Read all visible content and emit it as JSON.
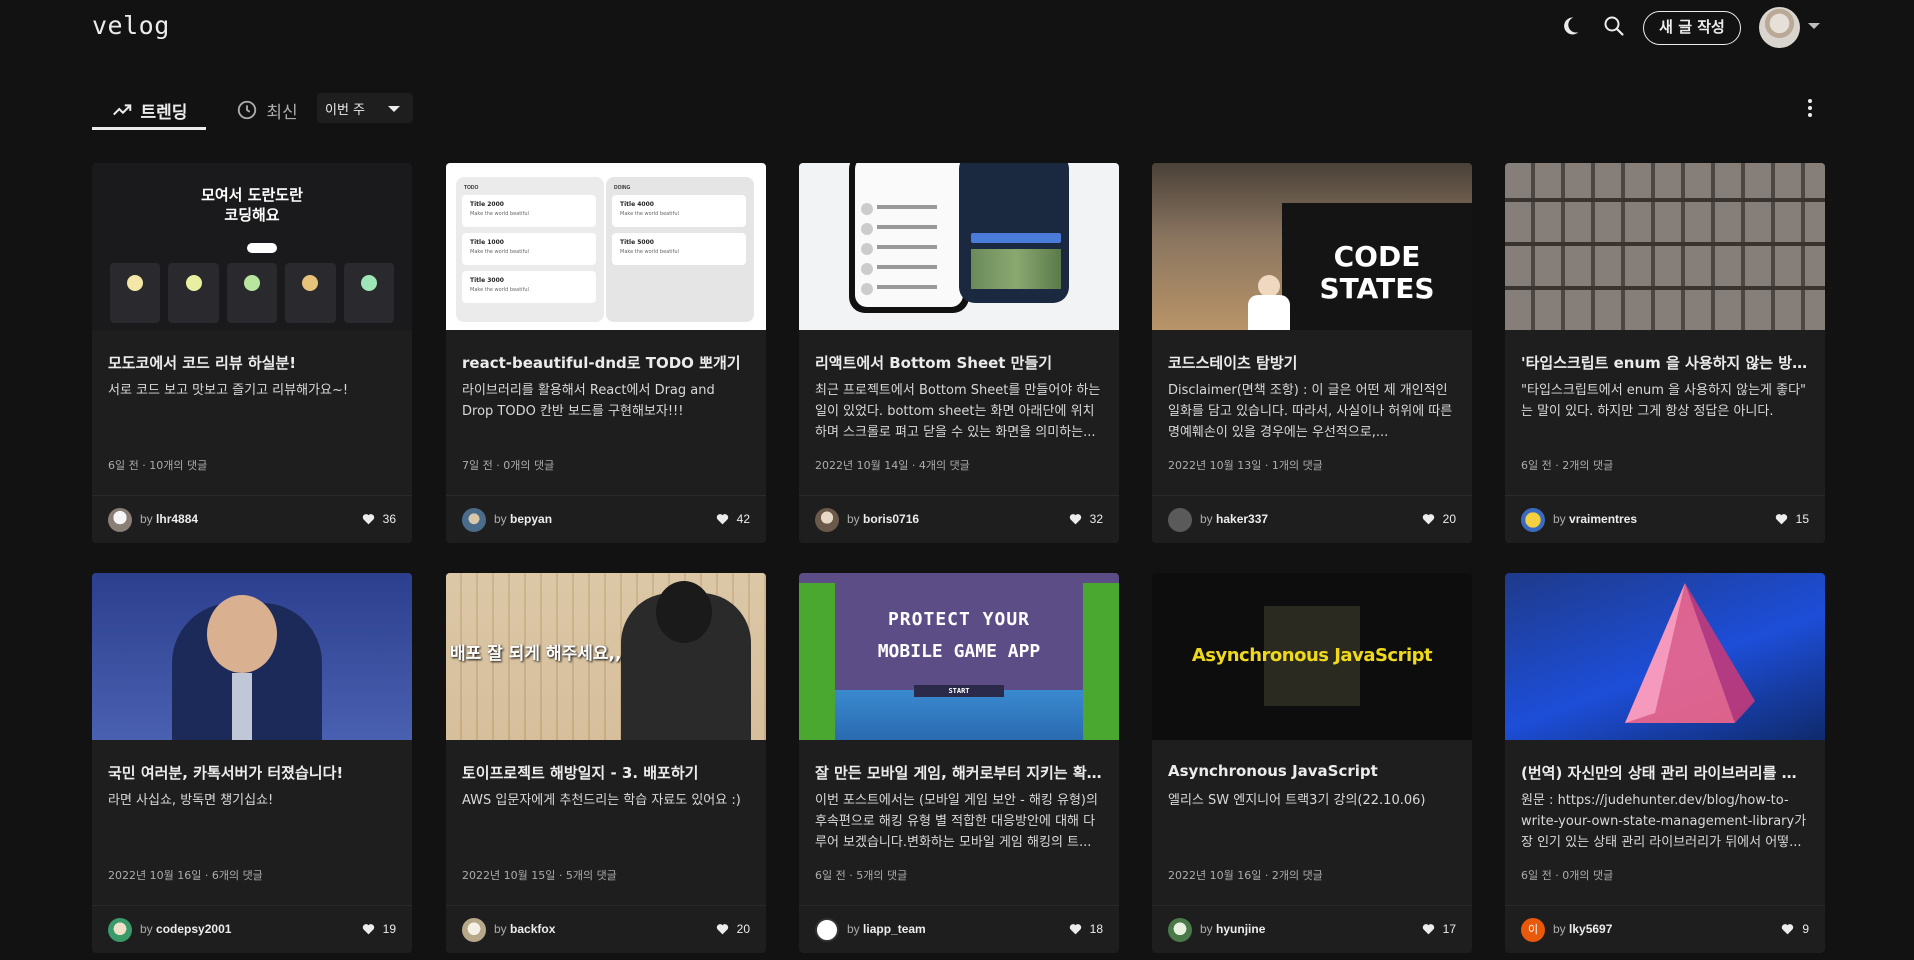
{
  "header": {
    "logo": "velog",
    "write_button": "새 글 작성"
  },
  "tabs": {
    "trending": "트렌딩",
    "recent": "최신",
    "period": "이번 주"
  },
  "thumb_text": {
    "modoco_title": "모여서 도란도란 코딩해요",
    "codestates": "CODE STATES",
    "deploy": "배포 잘 되게 해주세요,,",
    "game_line1": "PROTECT YOUR",
    "game_line2": "MOBILE GAME APP",
    "game_start": "START",
    "async": "Asynchronous JavaScript",
    "todo_col1": "TODO",
    "todo_col2": "DOING",
    "todo_items": [
      "Title 2000",
      "Title 1000",
      "Title 3000",
      "Title 4000",
      "Title 5000"
    ],
    "todo_sub": "Make the world beatiful"
  },
  "posts": [
    {
      "title": "모도코에서 코드 리뷰 하실분!",
      "desc": "서로 코드 보고 맛보고 즐기고 리뷰해가요~!",
      "meta": "6일 전 · 10개의 댓글",
      "author": "lhr4884",
      "likes": "36"
    },
    {
      "title": "react-beautiful-dnd로 TODO 뽀개기",
      "desc": "라이브러리를 활용해서 React에서 Drag and Drop TODO 칸반 보드를 구현해보자!!!",
      "meta": "7일 전 · 0개의 댓글",
      "author": "bepyan",
      "likes": "42"
    },
    {
      "title": "리액트에서 Bottom Sheet 만들기",
      "desc": "최근 프로젝트에서 Bottom Sheet를 만들어야 하는 일이 있었다. bottom sheet는 화면 아래단에 위치하며 스크롤로 펴고 닫을 수 있는 화면을 의미하는...",
      "meta": "2022년 10월 14일 · 4개의 댓글",
      "author": "boris0716",
      "likes": "32"
    },
    {
      "title": "코드스테이츠 탐방기",
      "desc": "Disclaimer(면책 조항) : 이 글은 어떤 제 개인적인 일화를 담고 있습니다. 따라서, 사실이나 허위에 따른 명예훼손이 있을 경우에는 우선적으로,...",
      "meta": "2022년 10월 13일 · 1개의 댓글",
      "author": "haker337",
      "likes": "20"
    },
    {
      "title": "'타입스크립트 enum 을 사용하지 않는 방...",
      "desc": "\"타입스크립트에서 enum 을 사용하지 않는게 좋다\" 는 말이 있다. 하지만 그게 항상 정답은 아니다.",
      "meta": "6일 전 · 2개의 댓글",
      "author": "vraimentres",
      "likes": "15"
    },
    {
      "title": "국민 여러분, 카톡서버가 터졌습니다!",
      "desc": "라면 사십쇼, 방독면 챙기십쇼!",
      "meta": "2022년 10월 16일 · 6개의 댓글",
      "author": "codepsy2001",
      "likes": "19"
    },
    {
      "title": "토이프로젝트 해방일지 - 3. 배포하기",
      "desc": "AWS 입문자에게 추천드리는 학습 자료도 있어요 :)",
      "meta": "2022년 10월 15일 · 5개의 댓글",
      "author": "backfox",
      "likes": "20"
    },
    {
      "title": "잘 만든 모바일 게임, 해커로부터 지키는 확...",
      "desc": "이번 포스트에서는 (모바일 게임 보안 - 해킹 유형)의 후속편으로 해킹 유형 별 적합한 대응방안에 대해 다루어 보겠습니다.변화하는 모바일 게임 해킹의 트...",
      "meta": "6일 전 · 5개의 댓글",
      "author": "liapp_team",
      "likes": "18"
    },
    {
      "title": "Asynchronous JavaScript",
      "desc": "엘리스 SW 엔지니어 트랙3기 강의(22.10.06)",
      "meta": "2022년 10월 16일 · 2개의 댓글",
      "author": "hyunjine",
      "likes": "17"
    },
    {
      "title": "(번역) 자신만의 상태 관리 라이브러리를 작...",
      "desc": "원문 : https://judehunter.dev/blog/how-to-write-your-own-state-management-library가장 인기 있는 상태 관리 라이브러리가 뒤에서 어떻...",
      "meta": "6일 전 · 0개의 댓글",
      "author": "lky5697",
      "likes": "9"
    }
  ],
  "by_label": "by",
  "avatar_letter": "이",
  "colors": {
    "background": "#121212",
    "card": "#1e1e1e",
    "text": "#ececec",
    "muted": "#acacac"
  }
}
